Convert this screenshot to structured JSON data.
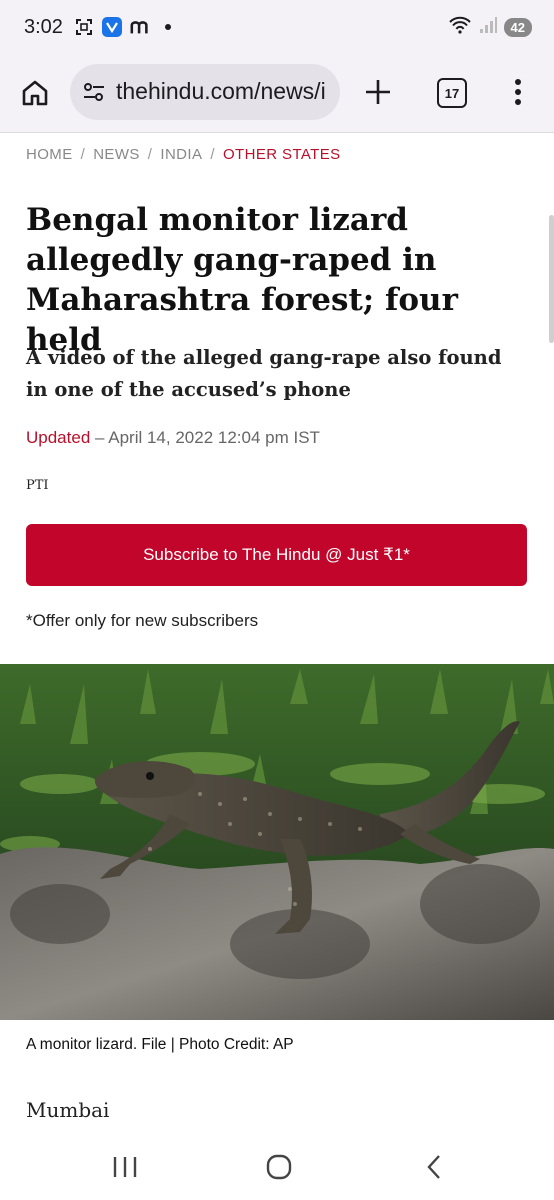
{
  "status_bar": {
    "time": "3:02",
    "battery": "42",
    "icons": [
      "screenshot-icon",
      "app-v-icon",
      "m-icon",
      "dot-icon",
      "wifi-icon",
      "signal-icon",
      "battery-icon"
    ]
  },
  "browser": {
    "url": "thehindu.com/news/i",
    "tab_count": "17",
    "icons": [
      "home-icon",
      "site-settings-icon",
      "new-tab-plus-icon",
      "tabs-icon",
      "menu-dots-icon"
    ]
  },
  "breadcrumb": {
    "items": [
      "HOME",
      "NEWS",
      "INDIA",
      "OTHER STATES"
    ],
    "separator": "/"
  },
  "article": {
    "headline": "Bengal monitor lizard allegedly gang-raped in Maharashtra forest; four held",
    "subheadline": "A video of the alleged gang-rape also found in one of the accused’s phone",
    "updated_label": "Updated",
    "updated_text": " – April 14, 2022 12:04 pm IST",
    "author": "PTI",
    "subscribe_button": "Subscribe to The Hindu @ Just ₹1*",
    "offer_note": "*Offer only for new subscribers",
    "image_caption": "A monitor lizard. File | Photo Credit: AP",
    "dateline": "Mumbai"
  },
  "colors": {
    "accent": "#c2062b",
    "breadcrumb_active": "#b8102b",
    "muted": "#888888",
    "chrome_bg": "#f5f2f7"
  },
  "nav": {
    "icons": [
      "recent-apps-icon",
      "home-circle-icon",
      "back-icon"
    ]
  }
}
